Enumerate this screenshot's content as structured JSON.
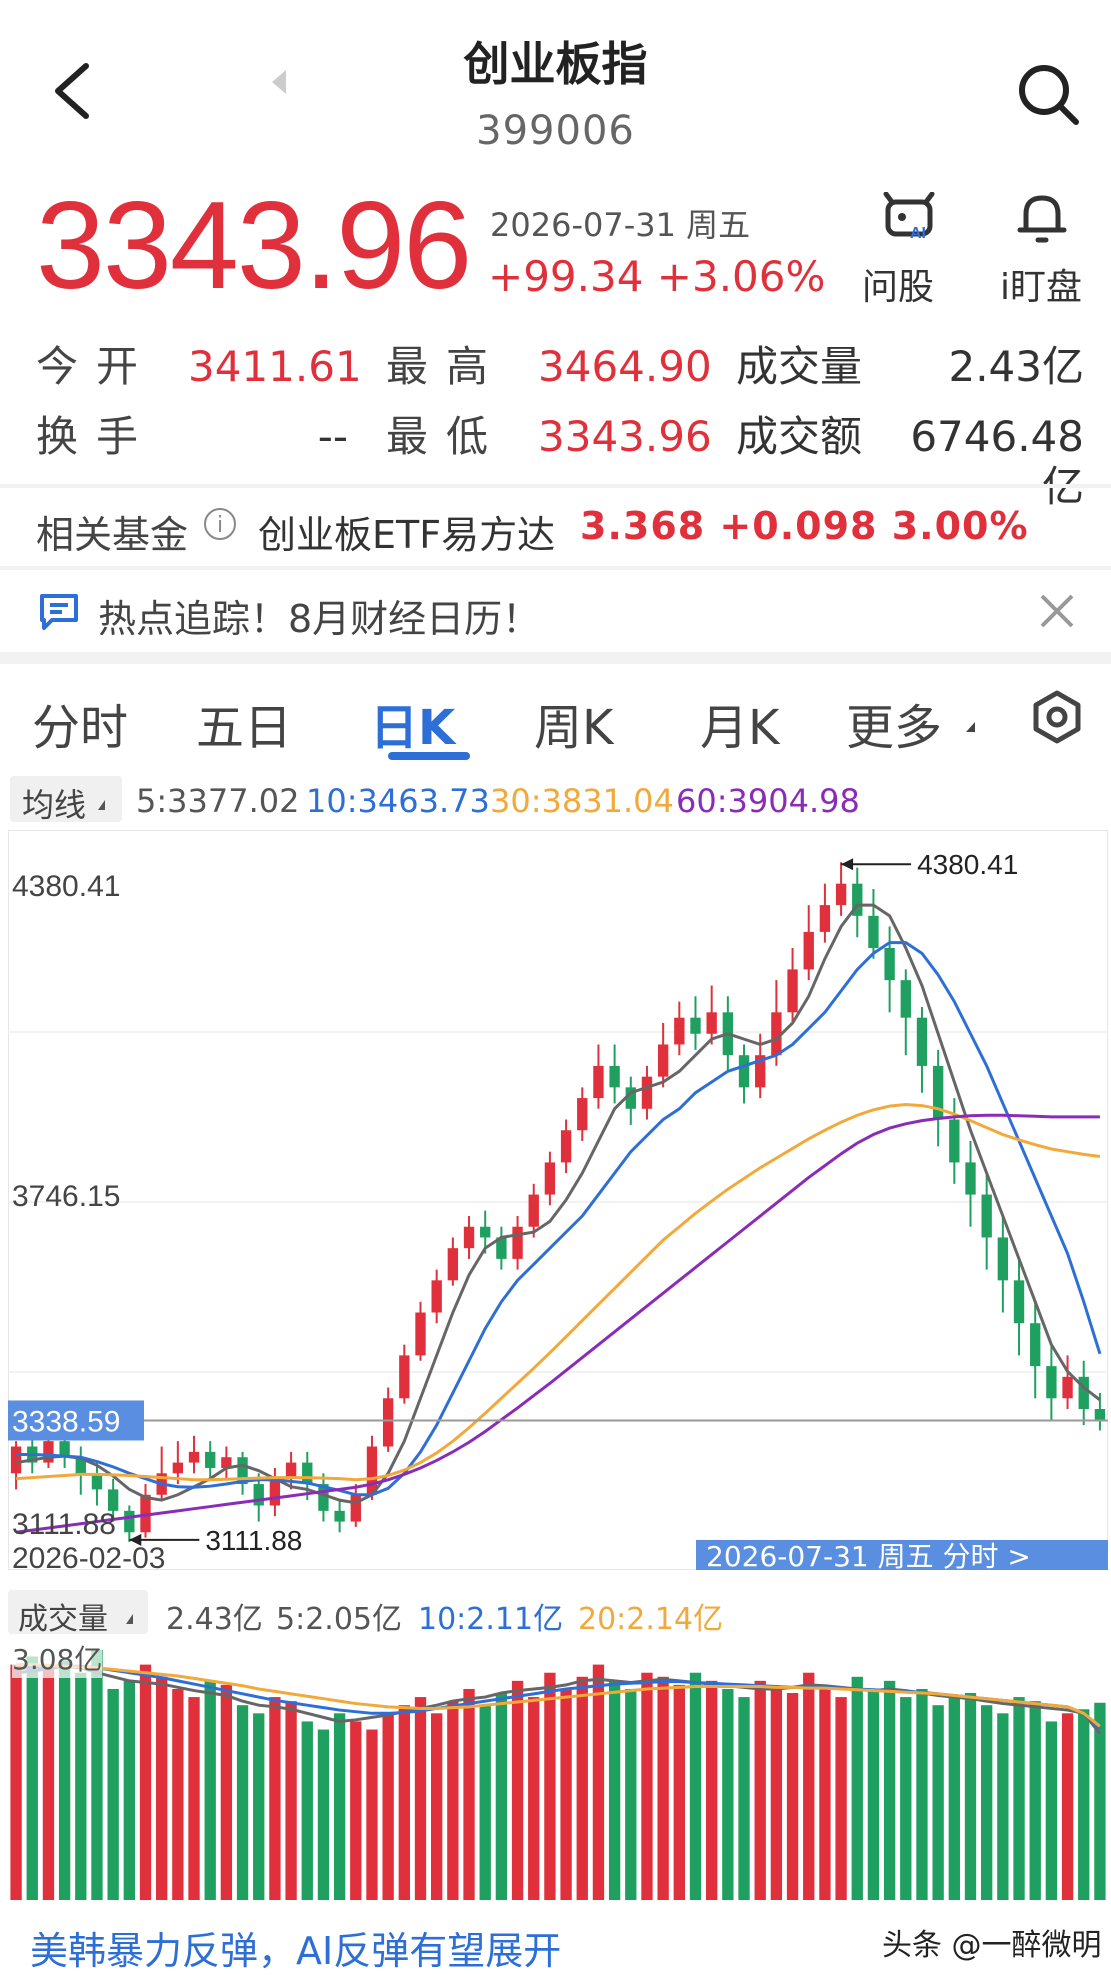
{
  "header": {
    "title": "创业板指",
    "code": "399006"
  },
  "quote": {
    "price": "3343.96",
    "date": "2026-07-31 周五",
    "change": "+99.34 +3.06%",
    "ask_label": "问股",
    "watch_label": "i盯盘"
  },
  "stats": {
    "open_label": "今开",
    "open": "3411.61",
    "high_label": "最高",
    "high": "3464.90",
    "volume_label": "成交量",
    "volume": "2.43亿",
    "turnover_label": "换手",
    "turnover": "--",
    "low_label": "最低",
    "low": "3343.96",
    "amount_label": "成交额",
    "amount": "6746.48亿"
  },
  "fund": {
    "label": "相关基金",
    "name": "创业板ETF易方达",
    "values": "3.368  +0.098  3.00%"
  },
  "news": {
    "text": "热点追踪！8月财经日历！"
  },
  "tabs": [
    {
      "label": "分时"
    },
    {
      "label": "五日"
    },
    {
      "label": "日K"
    },
    {
      "label": "周K"
    },
    {
      "label": "月K"
    },
    {
      "label": "更多"
    }
  ],
  "ma_legend": {
    "label": "均线",
    "ma5": "5:3377.02",
    "ma10": "10:3463.73",
    "ma30": "30:3831.04",
    "ma60": "60:3904.98"
  },
  "colors": {
    "up": "#e0303b",
    "down": "#20a060",
    "accent": "#2d6fd6",
    "ma5": "#666666",
    "ma10": "#2d6fd6",
    "ma30": "#f2a93b",
    "ma60": "#8a2cb8"
  },
  "chart_data": {
    "type": "candlestick",
    "y_labels": [
      "4380.41",
      "3746.15",
      "3111.88"
    ],
    "ylim": [
      3111.88,
      4380.41
    ],
    "current_price_label": "3338.59",
    "current_price": 3338.59,
    "max_annotation": "4380.41",
    "min_annotation": "3111.88",
    "start_date": "2026-02-03",
    "cursor_label": "2026-07-31 周五 分时 >",
    "candles": [
      [
        3240,
        3290,
        3210,
        3300
      ],
      [
        3290,
        3260,
        3240,
        3310
      ],
      [
        3260,
        3300,
        3250,
        3320
      ],
      [
        3300,
        3270,
        3250,
        3310
      ],
      [
        3270,
        3240,
        3200,
        3290
      ],
      [
        3240,
        3210,
        3180,
        3260
      ],
      [
        3210,
        3170,
        3150,
        3230
      ],
      [
        3170,
        3130,
        3112,
        3180
      ],
      [
        3130,
        3200,
        3120,
        3220
      ],
      [
        3200,
        3240,
        3190,
        3290
      ],
      [
        3240,
        3260,
        3220,
        3300
      ],
      [
        3260,
        3280,
        3240,
        3310
      ],
      [
        3280,
        3250,
        3230,
        3300
      ],
      [
        3250,
        3270,
        3230,
        3290
      ],
      [
        3270,
        3220,
        3200,
        3280
      ],
      [
        3220,
        3180,
        3150,
        3240
      ],
      [
        3180,
        3230,
        3160,
        3250
      ],
      [
        3230,
        3260,
        3210,
        3280
      ],
      [
        3260,
        3220,
        3190,
        3280
      ],
      [
        3220,
        3170,
        3150,
        3240
      ],
      [
        3170,
        3150,
        3130,
        3190
      ],
      [
        3150,
        3200,
        3140,
        3220
      ],
      [
        3200,
        3290,
        3190,
        3310
      ],
      [
        3290,
        3380,
        3280,
        3400
      ],
      [
        3380,
        3460,
        3370,
        3480
      ],
      [
        3460,
        3540,
        3450,
        3560
      ],
      [
        3540,
        3600,
        3520,
        3620
      ],
      [
        3600,
        3660,
        3590,
        3680
      ],
      [
        3660,
        3700,
        3640,
        3720
      ],
      [
        3700,
        3680,
        3650,
        3730
      ],
      [
        3680,
        3640,
        3620,
        3700
      ],
      [
        3640,
        3700,
        3620,
        3720
      ],
      [
        3700,
        3760,
        3680,
        3780
      ],
      [
        3760,
        3820,
        3740,
        3840
      ],
      [
        3820,
        3880,
        3800,
        3900
      ],
      [
        3880,
        3940,
        3860,
        3960
      ],
      [
        3940,
        4000,
        3920,
        4040
      ],
      [
        4000,
        3960,
        3930,
        4040
      ],
      [
        3960,
        3920,
        3890,
        3980
      ],
      [
        3920,
        3980,
        3900,
        4000
      ],
      [
        3980,
        4040,
        3960,
        4080
      ],
      [
        4040,
        4090,
        4020,
        4120
      ],
      [
        4090,
        4060,
        4030,
        4130
      ],
      [
        4060,
        4100,
        4040,
        4150
      ],
      [
        4100,
        4020,
        3990,
        4130
      ],
      [
        4020,
        3960,
        3930,
        4040
      ],
      [
        3960,
        4020,
        3940,
        4060
      ],
      [
        4020,
        4100,
        4000,
        4160
      ],
      [
        4100,
        4180,
        4080,
        4220
      ],
      [
        4180,
        4250,
        4160,
        4300
      ],
      [
        4250,
        4300,
        4230,
        4340
      ],
      [
        4300,
        4340,
        4280,
        4380
      ],
      [
        4340,
        4280,
        4240,
        4370
      ],
      [
        4280,
        4220,
        4200,
        4330
      ],
      [
        4220,
        4160,
        4100,
        4260
      ],
      [
        4160,
        4090,
        4020,
        4180
      ],
      [
        4090,
        4000,
        3950,
        4110
      ],
      [
        4000,
        3900,
        3850,
        4030
      ],
      [
        3900,
        3820,
        3780,
        3940
      ],
      [
        3820,
        3760,
        3700,
        3860
      ],
      [
        3760,
        3680,
        3620,
        3800
      ],
      [
        3680,
        3600,
        3540,
        3720
      ],
      [
        3600,
        3520,
        3460,
        3640
      ],
      [
        3520,
        3440,
        3380,
        3560
      ],
      [
        3440,
        3380,
        3340,
        3480
      ],
      [
        3380,
        3420,
        3360,
        3460
      ],
      [
        3420,
        3360,
        3330,
        3450
      ],
      [
        3360,
        3340,
        3320,
        3390
      ]
    ],
    "ma": {
      "ma5": [
        3260,
        3265,
        3270,
        3272,
        3268,
        3255,
        3235,
        3210,
        3195,
        3190,
        3200,
        3215,
        3230,
        3250,
        3255,
        3245,
        3230,
        3215,
        3210,
        3200,
        3190,
        3185,
        3200,
        3240,
        3300,
        3380,
        3460,
        3540,
        3610,
        3660,
        3680,
        3685,
        3690,
        3710,
        3750,
        3800,
        3860,
        3920,
        3950,
        3960,
        3970,
        3990,
        4020,
        4050,
        4060,
        4050,
        4040,
        4050,
        4080,
        4130,
        4200,
        4260,
        4300,
        4300,
        4280,
        4220,
        4150,
        4060,
        3970,
        3880,
        3800,
        3720,
        3640,
        3560,
        3480,
        3430,
        3400,
        3377
      ],
      "ma10": [
        3275,
        3275,
        3274,
        3272,
        3270,
        3262,
        3252,
        3240,
        3230,
        3220,
        3215,
        3214,
        3216,
        3220,
        3225,
        3228,
        3228,
        3225,
        3222,
        3215,
        3208,
        3200,
        3200,
        3212,
        3240,
        3280,
        3330,
        3390,
        3450,
        3510,
        3560,
        3600,
        3630,
        3660,
        3690,
        3720,
        3760,
        3800,
        3840,
        3870,
        3900,
        3920,
        3950,
        3970,
        3990,
        4000,
        4010,
        4020,
        4040,
        4070,
        4100,
        4140,
        4180,
        4210,
        4230,
        4230,
        4210,
        4170,
        4120,
        4060,
        4000,
        3930,
        3860,
        3790,
        3720,
        3650,
        3560,
        3463
      ],
      "ma30": [
        3230,
        3232,
        3234,
        3236,
        3238,
        3238,
        3237,
        3236,
        3234,
        3232,
        3230,
        3228,
        3228,
        3229,
        3230,
        3231,
        3232,
        3232,
        3232,
        3231,
        3230,
        3228,
        3230,
        3236,
        3246,
        3260,
        3278,
        3300,
        3325,
        3352,
        3380,
        3408,
        3436,
        3465,
        3495,
        3525,
        3555,
        3585,
        3615,
        3645,
        3675,
        3700,
        3725,
        3748,
        3770,
        3790,
        3810,
        3828,
        3846,
        3864,
        3880,
        3895,
        3908,
        3918,
        3925,
        3928,
        3926,
        3920,
        3910,
        3898,
        3885,
        3872,
        3862,
        3853,
        3845,
        3840,
        3835,
        3831
      ],
      "ma60": [
        3130,
        3134,
        3138,
        3142,
        3146,
        3150,
        3154,
        3158,
        3162,
        3166,
        3170,
        3174,
        3178,
        3182,
        3186,
        3190,
        3194,
        3198,
        3202,
        3206,
        3210,
        3214,
        3220,
        3228,
        3238,
        3250,
        3264,
        3280,
        3298,
        3318,
        3340,
        3362,
        3385,
        3408,
        3432,
        3456,
        3480,
        3504,
        3528,
        3552,
        3576,
        3600,
        3624,
        3648,
        3672,
        3696,
        3720,
        3744,
        3768,
        3792,
        3814,
        3836,
        3856,
        3872,
        3884,
        3892,
        3898,
        3902,
        3905,
        3907,
        3908,
        3908,
        3907,
        3906,
        3905,
        3905,
        3905,
        3905
      ]
    }
  },
  "volume": {
    "label": "成交量",
    "current": "2.43亿",
    "ma5": "5:2.05亿",
    "ma10": "10:2.11亿",
    "ma20": "20:2.14亿",
    "max_label": "3.08亿",
    "max": 3.08,
    "values": [
      2.9,
      3.0,
      2.85,
      2.95,
      2.8,
      3.08,
      2.6,
      2.7,
      2.9,
      2.75,
      2.6,
      2.5,
      2.7,
      2.65,
      2.4,
      2.3,
      2.5,
      2.45,
      2.2,
      2.1,
      2.3,
      2.2,
      2.1,
      2.3,
      2.4,
      2.5,
      2.3,
      2.45,
      2.6,
      2.4,
      2.55,
      2.7,
      2.5,
      2.8,
      2.6,
      2.75,
      2.9,
      2.7,
      2.6,
      2.8,
      2.75,
      2.65,
      2.8,
      2.7,
      2.6,
      2.5,
      2.7,
      2.6,
      2.55,
      2.8,
      2.6,
      2.5,
      2.75,
      2.6,
      2.7,
      2.5,
      2.6,
      2.4,
      2.5,
      2.55,
      2.4,
      2.3,
      2.5,
      2.45,
      2.2,
      2.3,
      2.35,
      2.43
    ],
    "ma_lines": {
      "ma5": [
        2.8,
        2.82,
        2.85,
        2.88,
        2.86,
        2.8,
        2.75,
        2.7,
        2.68,
        2.66,
        2.62,
        2.58,
        2.55,
        2.52,
        2.45,
        2.4,
        2.38,
        2.35,
        2.3,
        2.25,
        2.2,
        2.22,
        2.25,
        2.28,
        2.32,
        2.36,
        2.4,
        2.45,
        2.48,
        2.5,
        2.55,
        2.58,
        2.6,
        2.62,
        2.65,
        2.7,
        2.72,
        2.7,
        2.68,
        2.7,
        2.72,
        2.7,
        2.68,
        2.66,
        2.64,
        2.62,
        2.6,
        2.6,
        2.62,
        2.65,
        2.64,
        2.62,
        2.6,
        2.58,
        2.6,
        2.58,
        2.55,
        2.52,
        2.5,
        2.48,
        2.45,
        2.42,
        2.4,
        2.38,
        2.36,
        2.34,
        2.3,
        2.05
      ],
      "ma10": [
        2.85,
        2.86,
        2.87,
        2.88,
        2.88,
        2.86,
        2.83,
        2.8,
        2.77,
        2.74,
        2.7,
        2.66,
        2.62,
        2.58,
        2.54,
        2.5,
        2.46,
        2.43,
        2.4,
        2.37,
        2.34,
        2.32,
        2.3,
        2.3,
        2.31,
        2.33,
        2.36,
        2.39,
        2.42,
        2.45,
        2.48,
        2.51,
        2.54,
        2.57,
        2.6,
        2.62,
        2.64,
        2.66,
        2.67,
        2.68,
        2.69,
        2.69,
        2.68,
        2.67,
        2.66,
        2.65,
        2.64,
        2.63,
        2.62,
        2.62,
        2.62,
        2.61,
        2.6,
        2.59,
        2.58,
        2.57,
        2.56,
        2.54,
        2.52,
        2.5,
        2.48,
        2.46,
        2.44,
        2.42,
        2.4,
        2.38,
        2.3,
        2.11
      ],
      "ma20": [
        2.9,
        2.9,
        2.89,
        2.88,
        2.87,
        2.86,
        2.84,
        2.82,
        2.8,
        2.78,
        2.76,
        2.73,
        2.7,
        2.67,
        2.64,
        2.6,
        2.57,
        2.54,
        2.51,
        2.48,
        2.45,
        2.42,
        2.4,
        2.38,
        2.37,
        2.36,
        2.36,
        2.37,
        2.38,
        2.4,
        2.42,
        2.44,
        2.46,
        2.48,
        2.5,
        2.52,
        2.54,
        2.56,
        2.58,
        2.6,
        2.61,
        2.62,
        2.63,
        2.63,
        2.63,
        2.63,
        2.63,
        2.62,
        2.62,
        2.61,
        2.61,
        2.6,
        2.59,
        2.58,
        2.57,
        2.56,
        2.55,
        2.54,
        2.52,
        2.5,
        2.48,
        2.46,
        2.44,
        2.42,
        2.4,
        2.38,
        2.3,
        2.14
      ]
    }
  },
  "footer": {
    "banner": "美韩暴力反弹，AI反弹有望展开",
    "watermark": "头条 @一醉微明"
  }
}
